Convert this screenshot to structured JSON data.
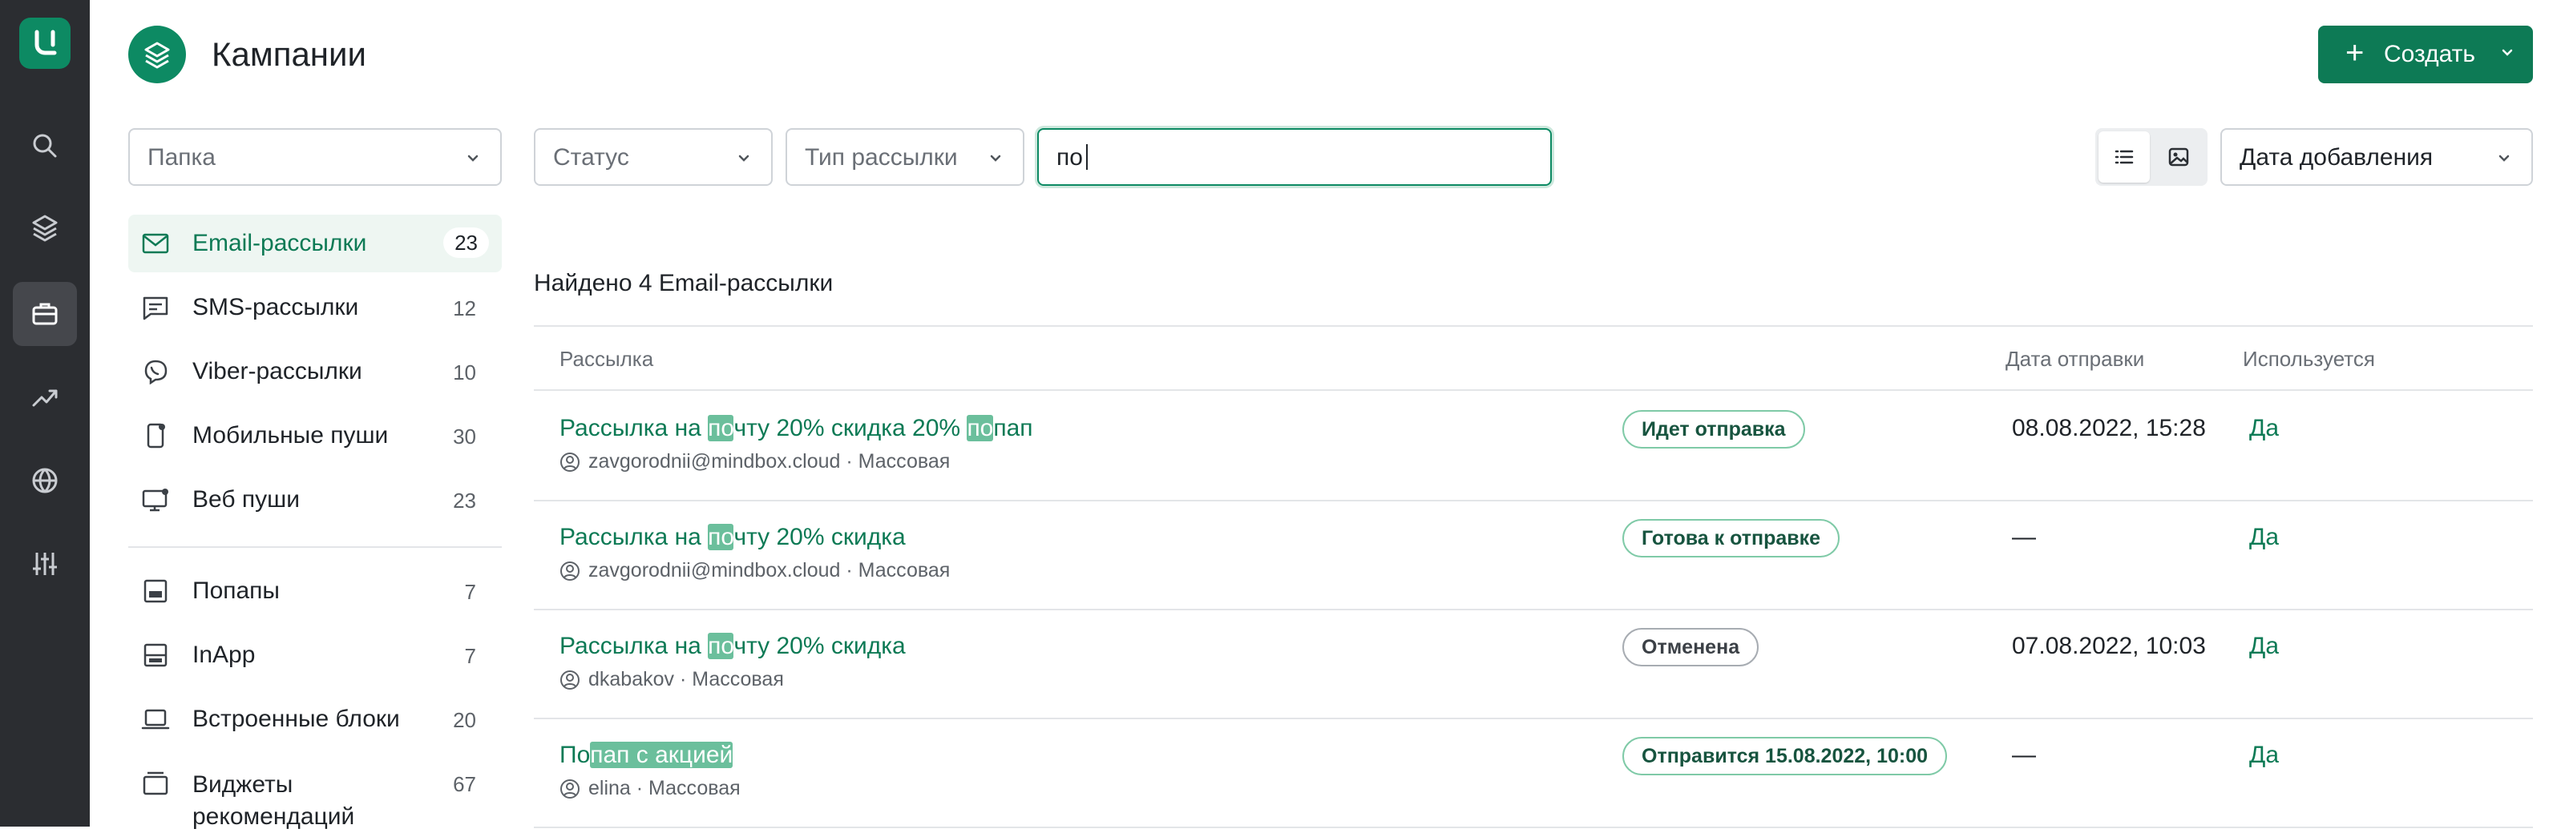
{
  "header": {
    "title": "Кампании",
    "create_label": "Создать"
  },
  "filters": {
    "folder_placeholder": "Папка",
    "status_placeholder": "Статус",
    "type_placeholder": "Тип рассылки",
    "search_value": "по",
    "sort_value": "Дата добавления"
  },
  "sidebar": {
    "items": [
      {
        "label": "Email-рассылки",
        "count": "23"
      },
      {
        "label": "SMS-рассылки",
        "count": "12"
      },
      {
        "label": "Viber-рассылки",
        "count": "10"
      },
      {
        "label": "Мобильные пуши",
        "count": "30"
      },
      {
        "label": "Веб пуши",
        "count": "23"
      },
      {
        "label": "Попапы",
        "count": "7"
      },
      {
        "label": "InApp",
        "count": "7"
      },
      {
        "label": "Встроенные блоки",
        "count": "20"
      },
      {
        "label_line1": "Виджеты",
        "label_line2": "рекомендаций",
        "count": "67"
      }
    ]
  },
  "results": {
    "found_text": "Найдено 4 Email-рассылки",
    "columns": {
      "name": "Рассылка",
      "date": "Дата отправки",
      "used": "Используется"
    },
    "rows": [
      {
        "name_parts": [
          "Рассылка на ",
          "по",
          "чту 20% скидка 20% ",
          "по",
          "пап"
        ],
        "author": "zavgorodnii@mindbox.cloud",
        "type": "Массовая",
        "status": "Идет отправка",
        "date": "08.08.2022, 15:28",
        "used": "Да"
      },
      {
        "name_parts": [
          "Рассылка на ",
          "по",
          "чту 20% скидка"
        ],
        "author": "zavgorodnii@mindbox.cloud",
        "type": "Массовая",
        "status": "Готова к отправке",
        "date": "—",
        "used": "Да"
      },
      {
        "name_parts": [
          "Рассылка на ",
          "по",
          "чту 20% скидка"
        ],
        "author": "dkabakov",
        "type": "Массовая",
        "status": "Отменена",
        "date": "07.08.2022, 10:03",
        "used": "Да"
      },
      {
        "name_parts": [
          "По",
          "пап с акцией"
        ],
        "author": "elina",
        "type": "Массовая",
        "status": "Отправится 15.08.2022, 10:00",
        "date": "—",
        "used": "Да"
      }
    ]
  },
  "meta_separator": " · ",
  "colors": {
    "accent": "#0d8a63",
    "rail": "#2b2d31",
    "highlight": "#6bbf9c"
  }
}
